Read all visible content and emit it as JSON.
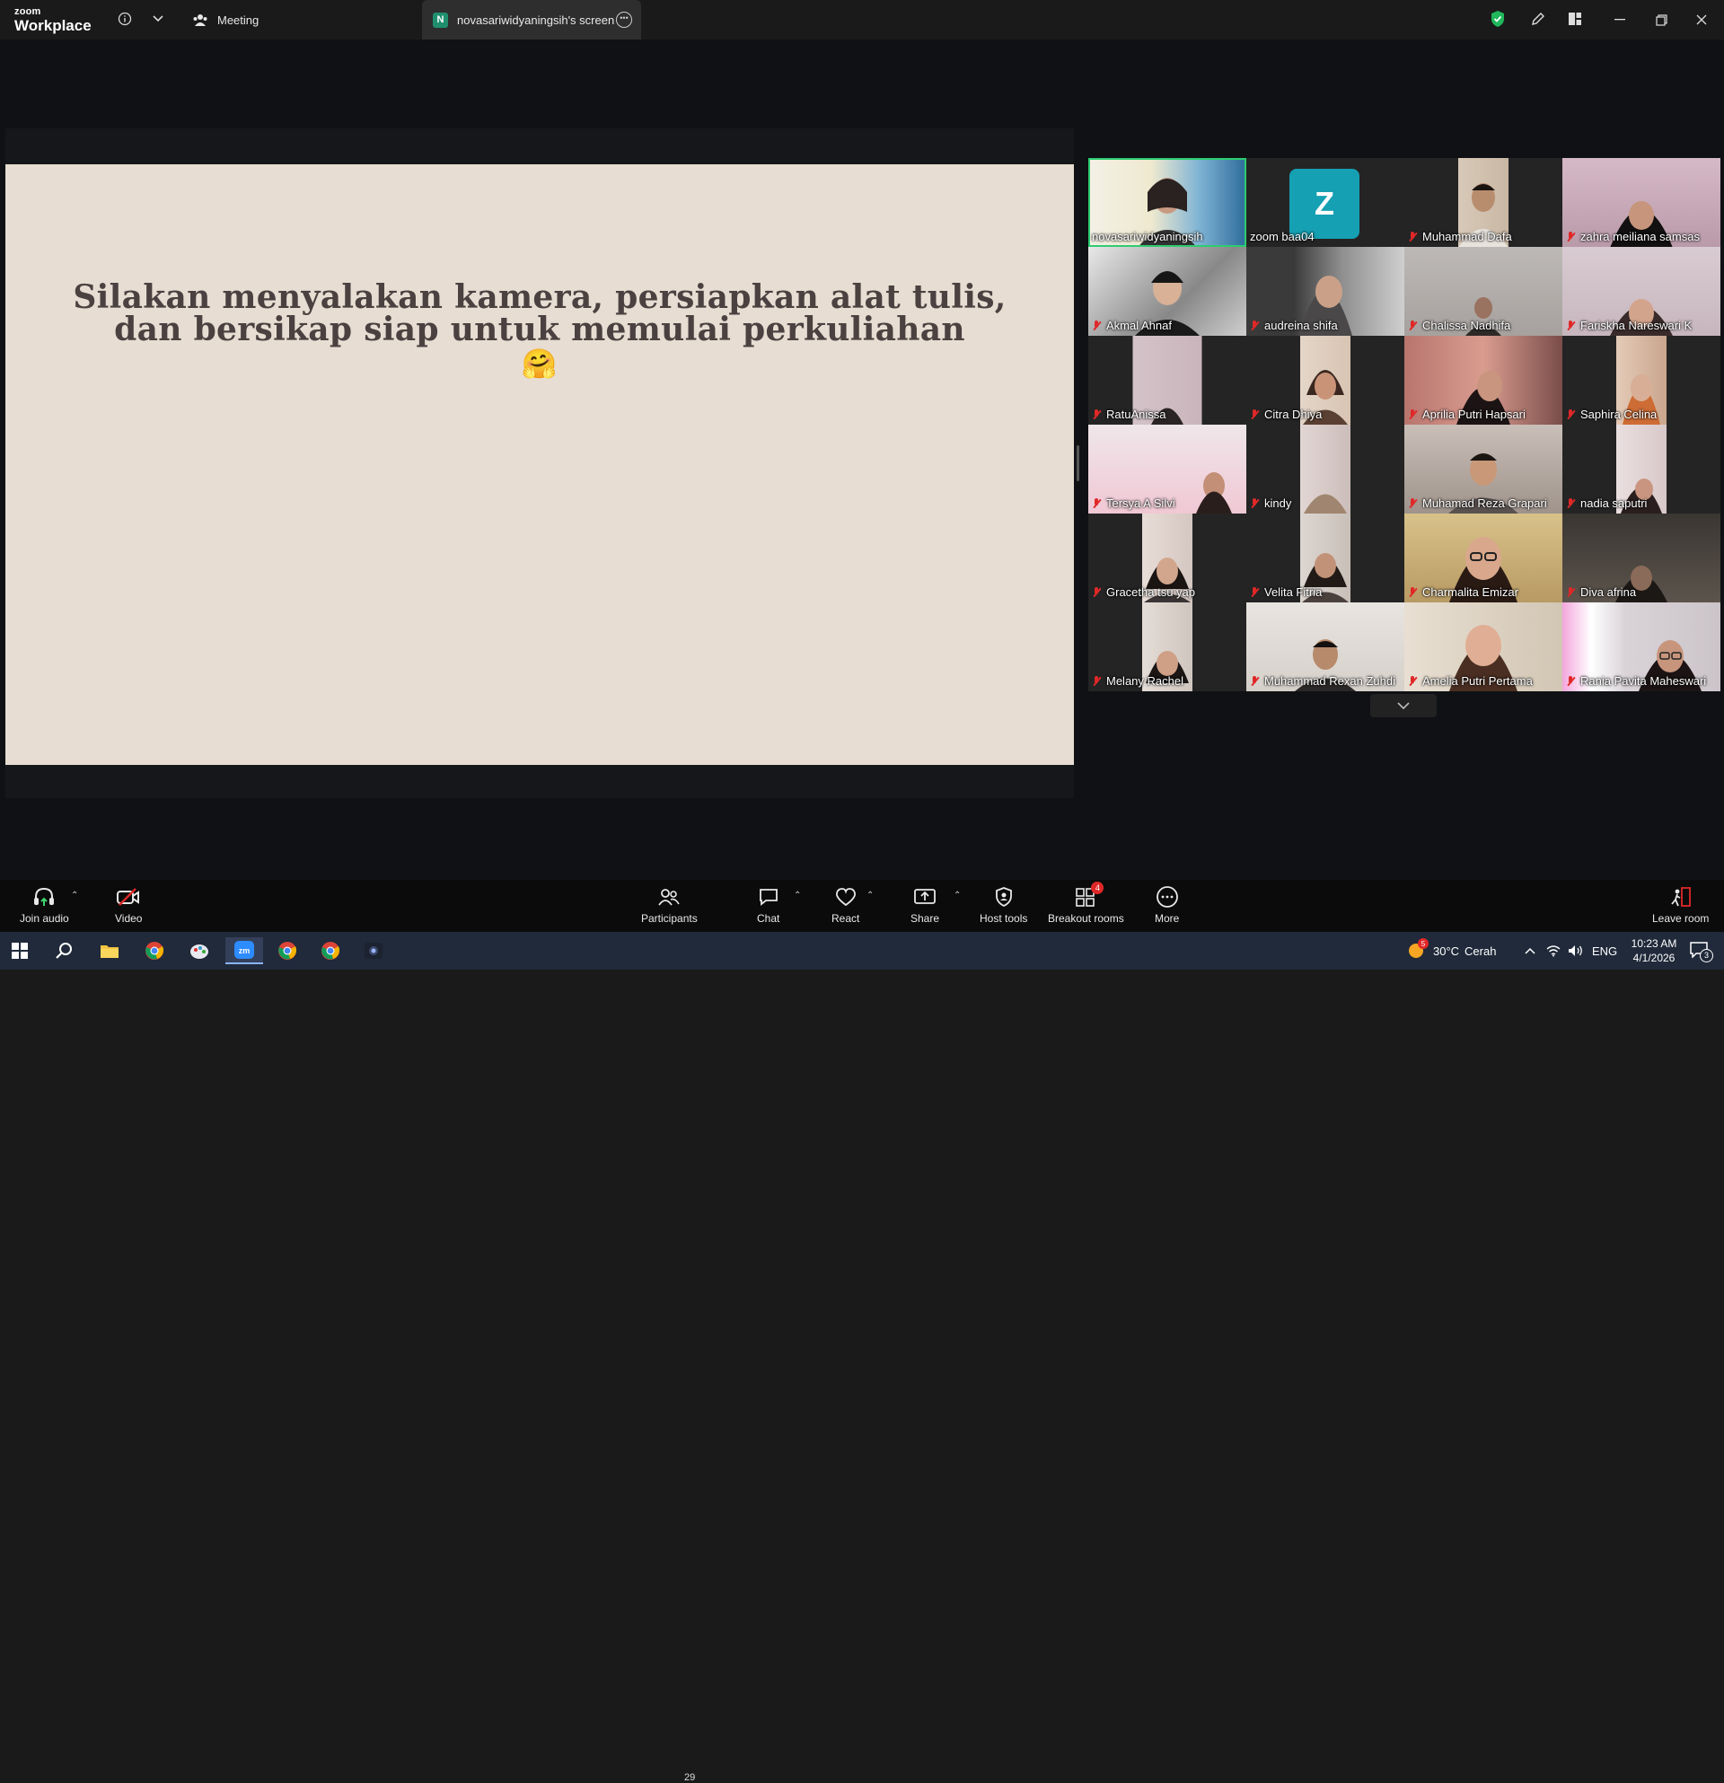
{
  "app": {
    "logo_line1": "zoom",
    "logo_line2": "Workplace"
  },
  "titlebar": {
    "tabs": [
      {
        "label": "Meeting"
      },
      {
        "label": "novasariwidyaningsih's screen",
        "badge": "N"
      }
    ]
  },
  "slide": {
    "line1": "Silakan menyalakan kamera, persiapkan alat tulis,",
    "line2": "dan bersikap siap untuk memulai perkuliahan",
    "emoji": "🤗"
  },
  "gallery": {
    "participants": [
      {
        "name": "novasariwidyaningsih",
        "muted": false,
        "active": true
      },
      {
        "name": "zoom baa04",
        "muted": false,
        "avatar": "Z"
      },
      {
        "name": "Muhammad Dafa",
        "muted": true
      },
      {
        "name": "zahra meiliana samsas",
        "muted": true
      },
      {
        "name": "Akmal Ahnaf",
        "muted": true
      },
      {
        "name": "audreina shifa",
        "muted": true
      },
      {
        "name": "Chalissa Nadhifa",
        "muted": true
      },
      {
        "name": "Fariskha Nareswari K",
        "muted": true
      },
      {
        "name": "RatuAnissa",
        "muted": true
      },
      {
        "name": "Citra Dhiya",
        "muted": true
      },
      {
        "name": "Aprilia Putri Hapsari",
        "muted": true
      },
      {
        "name": "Saphira Celina",
        "muted": true
      },
      {
        "name": "Tersya A Silvi",
        "muted": true
      },
      {
        "name": "kindy",
        "muted": true
      },
      {
        "name": "Muhamad Reza Grapari",
        "muted": true
      },
      {
        "name": "nadia saputri",
        "muted": true
      },
      {
        "name": "Gracetha tsu yap",
        "muted": true
      },
      {
        "name": "Velita Fitria",
        "muted": true
      },
      {
        "name": "Charmalita Emizar",
        "muted": true
      },
      {
        "name": "Diva afrina",
        "muted": true
      },
      {
        "name": "Melany Rachel",
        "muted": true
      },
      {
        "name": "Muhammad Rexan Zuhdi",
        "muted": true
      },
      {
        "name": "Amelia Putri Pertama",
        "muted": true
      },
      {
        "name": "Rania Pavita Maheswari",
        "muted": true
      }
    ]
  },
  "toolbar": {
    "join_audio": "Join audio",
    "video": "Video",
    "participants": "Participants",
    "participants_count": "29",
    "chat": "Chat",
    "react": "React",
    "share": "Share",
    "host_tools": "Host tools",
    "breakout_rooms": "Breakout rooms",
    "breakout_badge": "4",
    "more": "More",
    "leave_room": "Leave room"
  },
  "taskbar": {
    "weather_temp": "30°C",
    "weather_desc": "Cerah",
    "weather_badge": "5",
    "language": "ENG",
    "time": "10:23 AM",
    "date": "4/1/2026",
    "notification_count": "3"
  },
  "colors": {
    "accent_green": "#2ecc71",
    "muted_red": "#e02828",
    "slide_bg": "#e7ddd2",
    "zoom_avatar": "#15a0b3"
  }
}
